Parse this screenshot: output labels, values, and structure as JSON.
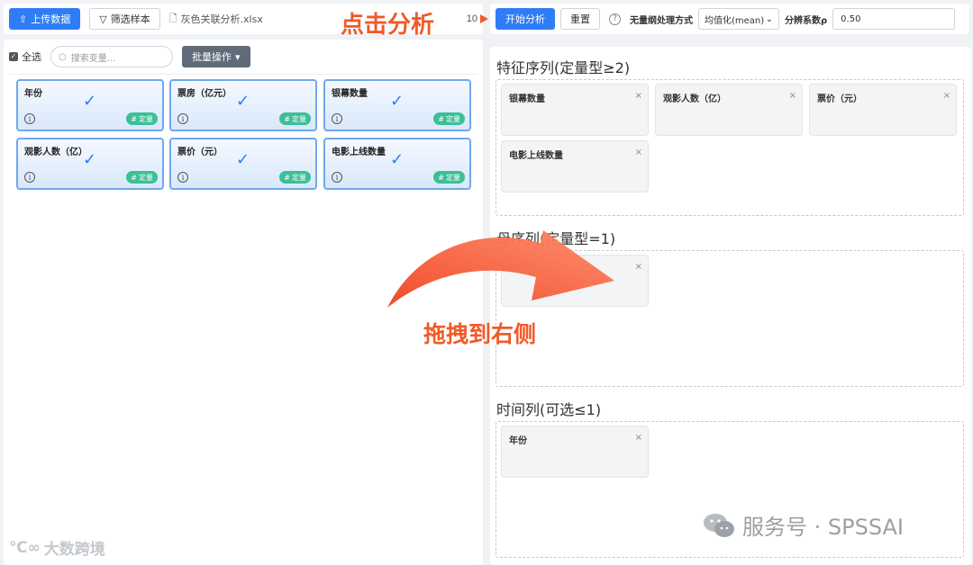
{
  "toolbar_left": {
    "upload_label": "上传数据",
    "filter_label": "筛选样本",
    "file_name": "灰色关联分析.xlsx",
    "count": "10"
  },
  "toolbar_right": {
    "start_label": "开始分析",
    "reset_label": "重置",
    "dimensionless_label": "无量纲处理方式",
    "dimensionless_value": "均值化(mean)",
    "rho_label": "分辨系数ρ",
    "rho_value": "0.50"
  },
  "left_panel": {
    "select_all_label": "全选",
    "search_placeholder": "搜索变量...",
    "batch_label": "批量操作",
    "variables": [
      {
        "name": "年份",
        "type": "定量"
      },
      {
        "name": "票房（亿元）",
        "type": "定量"
      },
      {
        "name": "银幕数量",
        "type": "定量"
      },
      {
        "name": "观影人数（亿）",
        "type": "定量"
      },
      {
        "name": "票价（元）",
        "type": "定量"
      },
      {
        "name": "电影上线数量",
        "type": "定量"
      }
    ]
  },
  "right_panel": {
    "feature_title": "特征序列(定量型≥2)",
    "feature_items": [
      "银幕数量",
      "观影人数（亿）",
      "票价（元）",
      "电影上线数量"
    ],
    "mother_title": "母序列(定量型=1)",
    "mother_items": [
      ""
    ],
    "time_title": "时间列(可选≤1)",
    "time_items": [
      "年份"
    ]
  },
  "annotations": {
    "click_hint": "点击分析",
    "drag_hint": "拖拽到右侧",
    "accent_color": "#f05a28"
  },
  "watermarks": {
    "right": "服务号 · SPSSAI",
    "left": "大数跨境"
  },
  "colors": {
    "primary": "#2f7df6",
    "card_border": "#6fa8ee",
    "badge": "#3bbf97",
    "batch_button": "#5f6b78"
  }
}
